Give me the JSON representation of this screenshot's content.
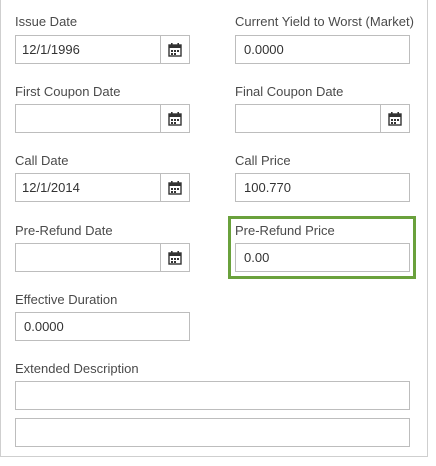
{
  "fields": {
    "issue_date": {
      "label": "Issue Date",
      "value": "12/1/1996"
    },
    "current_yield": {
      "label": "Current Yield to Worst (Market)",
      "value": "0.0000"
    },
    "first_coupon_date": {
      "label": "First Coupon Date",
      "value": ""
    },
    "final_coupon_date": {
      "label": "Final Coupon Date",
      "value": ""
    },
    "call_date": {
      "label": "Call Date",
      "value": "12/1/2014"
    },
    "call_price": {
      "label": "Call Price",
      "value": "100.770"
    },
    "pre_refund_date": {
      "label": "Pre-Refund Date",
      "value": ""
    },
    "pre_refund_price": {
      "label": "Pre-Refund Price",
      "value": "0.00"
    },
    "effective_duration": {
      "label": "Effective Duration",
      "value": "0.0000"
    },
    "extended_description": {
      "label": "Extended Description",
      "value_line1": "",
      "value_line2": ""
    }
  },
  "icons": {
    "calendar": "calendar-icon"
  },
  "colors": {
    "highlight": "#6aa13c",
    "border": "#bdbdbd"
  }
}
